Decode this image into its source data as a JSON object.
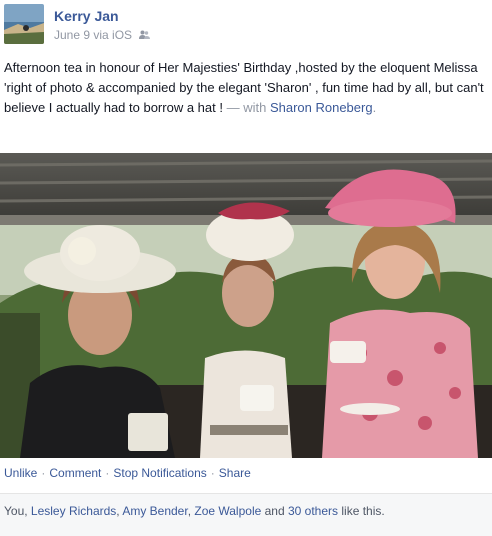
{
  "post": {
    "author": "Kerry Jan",
    "date": "June 9",
    "via": "via iOS",
    "audience_icon": "people-icon",
    "text": "Afternoon tea in honour of Her Majesties' Birthday ,hosted by the eloquent Melissa 'right of photo & accompanied by the elegant 'Sharon' , fun time had by all, but can't believe I actually had to borrow a hat ! ",
    "with_label": "— with",
    "tagged": "Sharon Roneberg",
    "tagged_end": "."
  },
  "actions": {
    "unlike": "Unlike",
    "comment": "Comment",
    "stop_notifications": "Stop Notifications",
    "share": "Share",
    "separator": "·"
  },
  "likes": {
    "prefix": "You, ",
    "names": [
      "Lesley Richards",
      "Amy Bender",
      "Zoe Walpole"
    ],
    "sep1": ", ",
    "sep2": ", ",
    "and": " and ",
    "others": "30 others",
    "suffix": " like this."
  }
}
